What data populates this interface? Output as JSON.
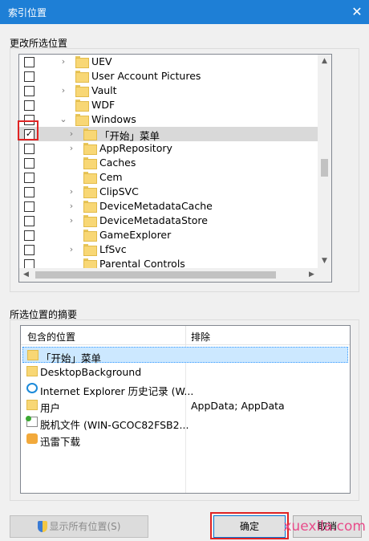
{
  "window": {
    "title": "索引位置",
    "close_glyph": "✕"
  },
  "change_group": {
    "label": "更改所选位置"
  },
  "tree": {
    "rows": [
      {
        "label": "UEV",
        "checked": false,
        "arrow": "›",
        "indent": 0
      },
      {
        "label": "User Account Pictures",
        "checked": false,
        "arrow": "",
        "indent": 0
      },
      {
        "label": "Vault",
        "checked": false,
        "arrow": "›",
        "indent": 0
      },
      {
        "label": "WDF",
        "checked": false,
        "arrow": "",
        "indent": 0
      },
      {
        "label": "Windows",
        "checked": false,
        "arrow": "⌄",
        "indent": 0
      },
      {
        "label": "「开始」菜单",
        "checked": true,
        "arrow": "›",
        "indent": 1
      },
      {
        "label": "AppRepository",
        "checked": false,
        "arrow": "›",
        "indent": 1
      },
      {
        "label": "Caches",
        "checked": false,
        "arrow": "",
        "indent": 1
      },
      {
        "label": "Cem",
        "checked": false,
        "arrow": "",
        "indent": 1
      },
      {
        "label": "ClipSVC",
        "checked": false,
        "arrow": "›",
        "indent": 1
      },
      {
        "label": "DeviceMetadataCache",
        "checked": false,
        "arrow": "›",
        "indent": 1
      },
      {
        "label": "DeviceMetadataStore",
        "checked": false,
        "arrow": "›",
        "indent": 1
      },
      {
        "label": "GameExplorer",
        "checked": false,
        "arrow": "",
        "indent": 1
      },
      {
        "label": "LfSvc",
        "checked": false,
        "arrow": "›",
        "indent": 1
      },
      {
        "label": "Parental Controls",
        "checked": false,
        "arrow": "",
        "indent": 1
      }
    ],
    "selected_label": "「开始」菜单",
    "check_glyph": "✓"
  },
  "summary_group": {
    "label": "所选位置的摘要"
  },
  "summary": {
    "col_included": "包含的位置",
    "col_excluded": "排除",
    "rows": [
      {
        "name": "「开始」菜单",
        "exclude": "",
        "icon": "folder-icon"
      },
      {
        "name": "DesktopBackground",
        "exclude": "",
        "icon": "folder-icon"
      },
      {
        "name": "Internet Explorer 历史记录 (W...",
        "exclude": "",
        "icon": "ie-icon"
      },
      {
        "name": "用户",
        "exclude": "AppData; AppData",
        "icon": "folder-icon"
      },
      {
        "name": "脱机文件 (WIN-GCOC82FSB2...",
        "exclude": "",
        "icon": "network-icon"
      },
      {
        "name": "迅雷下载",
        "exclude": "",
        "icon": "download-icon"
      }
    ]
  },
  "buttons": {
    "show_all": "显示所有位置(S)",
    "ok": "确定",
    "cancel": "取消"
  },
  "watermark": "xuexila.com",
  "colors": {
    "accent": "#1e7fd6",
    "highlight": "#e02424"
  }
}
